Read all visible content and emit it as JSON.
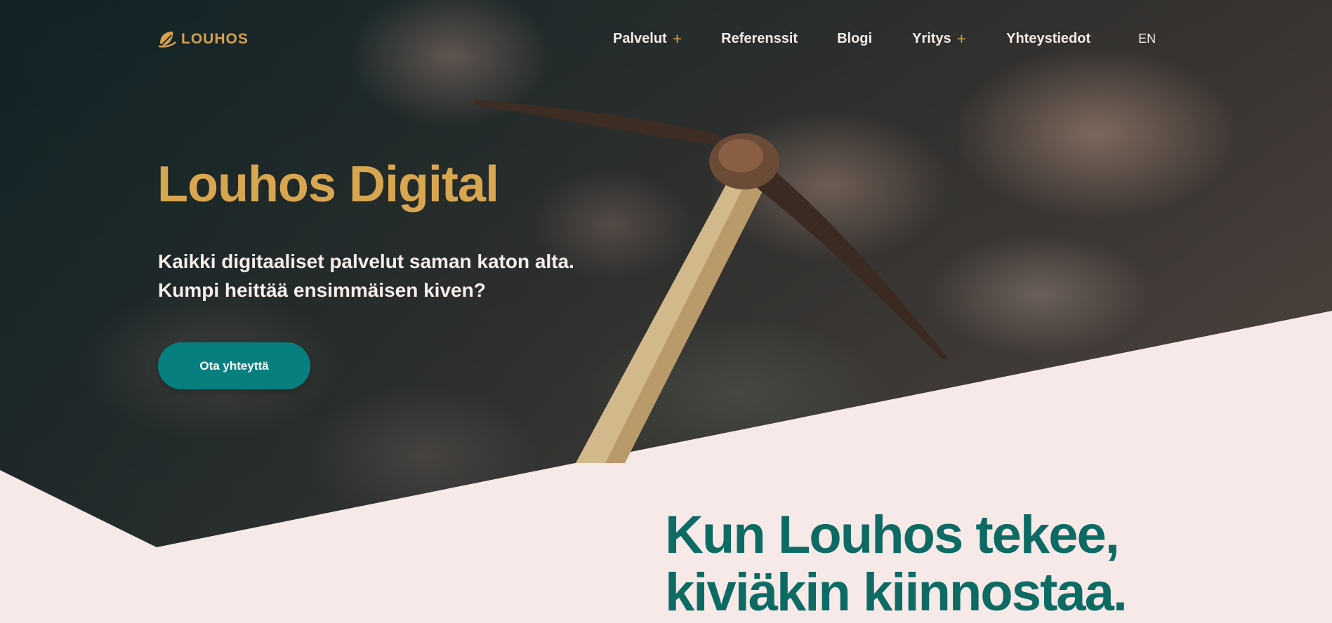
{
  "brand": {
    "name": "LOUHOS",
    "logo_icon": "louhos-leaf-logo",
    "accent": "#d6a04c",
    "teal": "#077f7f",
    "heading_teal": "#0d6b64",
    "blush": "#f7e9e8"
  },
  "nav": {
    "items": [
      {
        "label": "Palvelut",
        "has_submenu": true,
        "submenu_icon": "plus-icon"
      },
      {
        "label": "Referenssit",
        "has_submenu": false
      },
      {
        "label": "Blogi",
        "has_submenu": false
      },
      {
        "label": "Yritys",
        "has_submenu": true,
        "submenu_icon": "plus-icon"
      },
      {
        "label": "Yhteystiedot",
        "has_submenu": false
      }
    ],
    "language": "EN",
    "submenu_marker": "+"
  },
  "hero": {
    "title": "Louhos Digital",
    "subtitle_lines": [
      "Kaikki digitaaliset palvelut saman katon alta.",
      "Kumpi heittää ensimmäisen kiven?"
    ],
    "cta_label": "Ota yhteyttä",
    "background": "rocks-with-pickaxe-photo"
  },
  "intro": {
    "heading_lines": [
      "Kun Louhos tekee,",
      "kiviäkin kiinnostaa."
    ]
  }
}
